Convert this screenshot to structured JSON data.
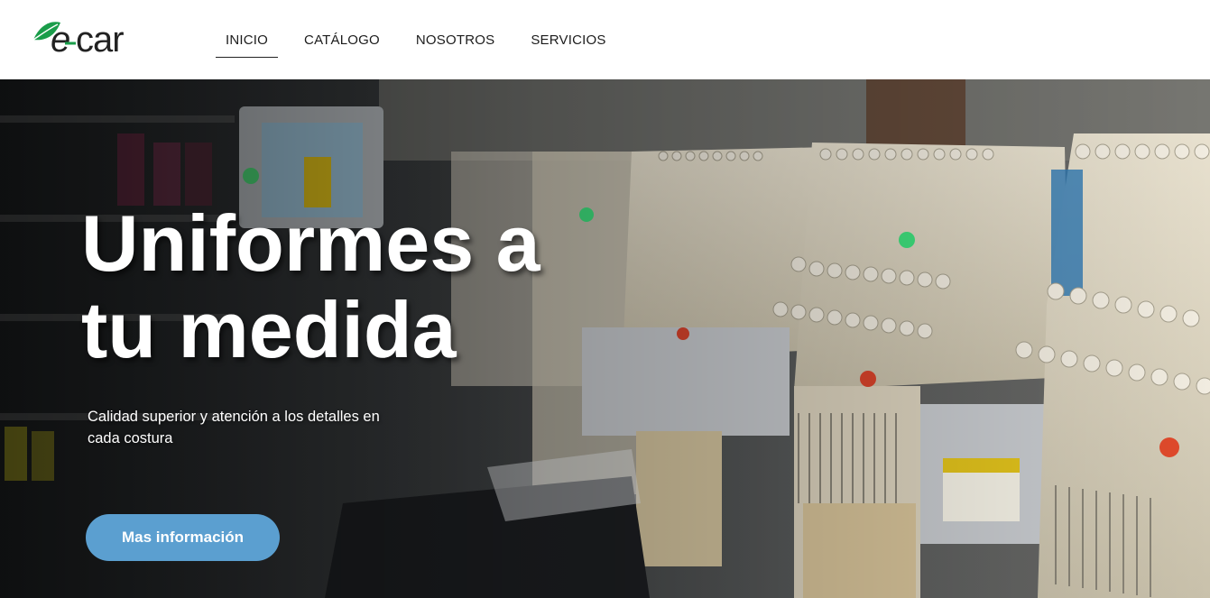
{
  "brand": {
    "logo_text": "e-car",
    "accent": "#1a9d4a"
  },
  "nav": {
    "items": [
      {
        "label": "INICIO",
        "active": true
      },
      {
        "label": "CATÁLOGO",
        "active": false
      },
      {
        "label": "NOSOTROS",
        "active": false
      },
      {
        "label": "SERVICIOS",
        "active": false
      }
    ]
  },
  "hero": {
    "title_line1": "Uniformes a",
    "title_line2": "tu medida",
    "subtitle": "Calidad superior y atención a los detalles en cada costura",
    "cta_label": "Mas información",
    "background_image": "embroidery-machines-photo",
    "cta_color": "#5b9fd0"
  }
}
